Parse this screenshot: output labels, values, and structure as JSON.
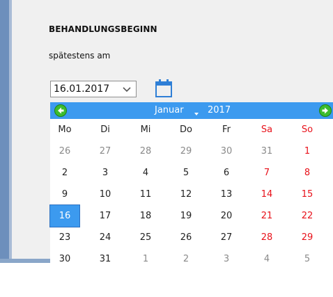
{
  "form": {
    "title": "BEHANDLUNGSBEGINN",
    "subtitle": "spätestens am",
    "date_value": "16.01.2017"
  },
  "calendar": {
    "month": "Januar",
    "year": "2017",
    "weekdays": [
      "Mo",
      "Di",
      "Mi",
      "Do",
      "Fr",
      "Sa",
      "So"
    ],
    "weeks": [
      [
        "26",
        "27",
        "28",
        "29",
        "30",
        "31",
        "1"
      ],
      [
        "2",
        "3",
        "4",
        "5",
        "6",
        "7",
        "8"
      ],
      [
        "9",
        "10",
        "11",
        "12",
        "13",
        "14",
        "15"
      ],
      [
        "16",
        "17",
        "18",
        "19",
        "20",
        "21",
        "22"
      ],
      [
        "23",
        "24",
        "25",
        "26",
        "27",
        "28",
        "29"
      ],
      [
        "30",
        "31",
        "1",
        "2",
        "3",
        "4",
        "5"
      ]
    ],
    "selected_day": "16",
    "colors": {
      "header": "#3c9aef",
      "weekend": "#e8111a",
      "nav_icon": "#3cbc2f"
    }
  }
}
